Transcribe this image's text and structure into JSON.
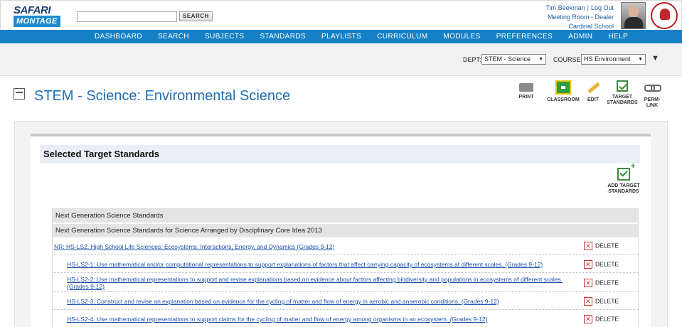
{
  "brand": {
    "logo_top": "SAFARI",
    "logo_bottom": "MONTAGE"
  },
  "search": {
    "value": "",
    "button_label": "SEARCH"
  },
  "user": {
    "name": "Tim Beekman",
    "logout": "Log Out",
    "room": "Meeting Room - Dealer",
    "school": "Cardinal School",
    "school_logo_text": "CARDINAL SCHOOL"
  },
  "nav": [
    "DASHBOARD",
    "SEARCH",
    "SUBJECTS",
    "STANDARDS",
    "PLAYLISTS",
    "CURRICULUM",
    "MODULES",
    "PREFERENCES",
    "ADMIN",
    "HELP"
  ],
  "filters": {
    "dept_label": "DEPT:",
    "dept_value": "STEM - Science",
    "course_label": "COURSE:",
    "course_value": "HS Environment"
  },
  "page": {
    "title": "STEM - Science: Environmental Science"
  },
  "toolbar": [
    {
      "label": "PRINT",
      "icon": "print-icon"
    },
    {
      "label": "CLASSROOM",
      "icon": "classroom-icon"
    },
    {
      "label": "EDIT",
      "icon": "edit-icon"
    },
    {
      "label": "TARGET STANDARDS",
      "icon": "target-standards-icon"
    },
    {
      "label": "PERM-LINK",
      "icon": "perm-link-icon"
    }
  ],
  "section": {
    "title": "Selected Target Standards",
    "add_label": "ADD TARGET STANDARDS"
  },
  "standards": {
    "group1": "Next Generation Science Standards",
    "group2": "Next Generation Science Standards for Science Arranged by Disciplinary Core Idea 2013",
    "delete_label": "DELETE",
    "rows": [
      {
        "text": "NR: HS-LS2: High School Life Sciences: Ecosystems: Interactions, Energy, and Dynamics (Grades 9-12)"
      },
      {
        "text": "HS-LS2-1: Use mathematical and/or computational representations to support explanations of factors that affect carrying capacity of ecosystems at different scales. (Grades 9-12)"
      },
      {
        "text": "HS-LS2-2: Use mathematical representations to support and revise explanations based on evidence about factors affecting biodiversity and populations in ecosystems of different scales. (Grades 9-12)"
      },
      {
        "text": "HS-LS2-3: Construct and revise an explanation based on evidence for the cycling of matter and flow of energy in aerobic and anaerobic conditions. (Grades 9-12)"
      },
      {
        "text": "HS-LS2-4: Use mathematical representations to support claims for the cycling of matter and flow of energy among organisms in an ecosystem. (Grades 9-12)"
      }
    ]
  }
}
